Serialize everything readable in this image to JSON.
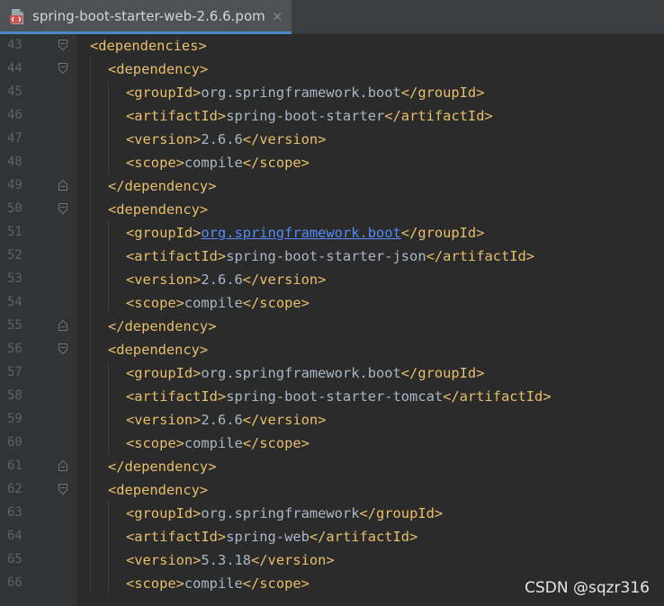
{
  "tab": {
    "title": "spring-boot-starter-web-2.6.6.pom",
    "close_glyph": "×",
    "icon": "maven-pom-file-icon"
  },
  "lines": [
    {
      "n": "43",
      "indent": 0,
      "fold": "open",
      "parts": [
        {
          "k": "tag",
          "t": "<dependencies>"
        }
      ]
    },
    {
      "n": "44",
      "indent": 1,
      "fold": "open",
      "parts": [
        {
          "k": "tag",
          "t": "<dependency>"
        }
      ]
    },
    {
      "n": "45",
      "indent": 2,
      "fold": "",
      "parts": [
        {
          "k": "tag",
          "t": "<groupId>"
        },
        {
          "k": "txt",
          "t": "org.springframework.boot"
        },
        {
          "k": "tag",
          "t": "</groupId>"
        }
      ]
    },
    {
      "n": "46",
      "indent": 2,
      "fold": "",
      "parts": [
        {
          "k": "tag",
          "t": "<artifactId>"
        },
        {
          "k": "txt",
          "t": "spring-boot-starter"
        },
        {
          "k": "tag",
          "t": "</artifactId>"
        }
      ]
    },
    {
      "n": "47",
      "indent": 2,
      "fold": "",
      "parts": [
        {
          "k": "tag",
          "t": "<version>"
        },
        {
          "k": "txt",
          "t": "2.6.6"
        },
        {
          "k": "tag",
          "t": "</version>"
        }
      ]
    },
    {
      "n": "48",
      "indent": 2,
      "fold": "",
      "parts": [
        {
          "k": "tag",
          "t": "<scope>"
        },
        {
          "k": "txt",
          "t": "compile"
        },
        {
          "k": "tag",
          "t": "</scope>"
        }
      ]
    },
    {
      "n": "49",
      "indent": 1,
      "fold": "close",
      "parts": [
        {
          "k": "tag",
          "t": "</dependency>"
        }
      ]
    },
    {
      "n": "50",
      "indent": 1,
      "fold": "open",
      "parts": [
        {
          "k": "tag",
          "t": "<dependency>"
        }
      ]
    },
    {
      "n": "51",
      "indent": 2,
      "fold": "",
      "parts": [
        {
          "k": "tag",
          "t": "<groupId>"
        },
        {
          "k": "link",
          "t": "org.springframework.boot"
        },
        {
          "k": "tag",
          "t": "</groupId>"
        }
      ]
    },
    {
      "n": "52",
      "indent": 2,
      "fold": "",
      "parts": [
        {
          "k": "tag",
          "t": "<artifactId>"
        },
        {
          "k": "txt",
          "t": "spring-boot-starter-json"
        },
        {
          "k": "tag",
          "t": "</artifactId>"
        }
      ]
    },
    {
      "n": "53",
      "indent": 2,
      "fold": "",
      "parts": [
        {
          "k": "tag",
          "t": "<version>"
        },
        {
          "k": "txt",
          "t": "2.6.6"
        },
        {
          "k": "tag",
          "t": "</version>"
        }
      ]
    },
    {
      "n": "54",
      "indent": 2,
      "fold": "",
      "parts": [
        {
          "k": "tag",
          "t": "<scope>"
        },
        {
          "k": "txt",
          "t": "compile"
        },
        {
          "k": "tag",
          "t": "</scope>"
        }
      ]
    },
    {
      "n": "55",
      "indent": 1,
      "fold": "close",
      "parts": [
        {
          "k": "tag",
          "t": "</dependency>"
        }
      ]
    },
    {
      "n": "56",
      "indent": 1,
      "fold": "open",
      "parts": [
        {
          "k": "tag",
          "t": "<dependency>"
        }
      ]
    },
    {
      "n": "57",
      "indent": 2,
      "fold": "",
      "parts": [
        {
          "k": "tag",
          "t": "<groupId>"
        },
        {
          "k": "txt",
          "t": "org.springframework.boot"
        },
        {
          "k": "tag",
          "t": "</groupId>"
        }
      ]
    },
    {
      "n": "58",
      "indent": 2,
      "fold": "",
      "parts": [
        {
          "k": "tag",
          "t": "<artifactId>"
        },
        {
          "k": "txt",
          "t": "spring-boot-starter-tomcat"
        },
        {
          "k": "tag",
          "t": "</artifactId>"
        }
      ]
    },
    {
      "n": "59",
      "indent": 2,
      "fold": "",
      "parts": [
        {
          "k": "tag",
          "t": "<version>"
        },
        {
          "k": "txt",
          "t": "2.6.6"
        },
        {
          "k": "tag",
          "t": "</version>"
        }
      ]
    },
    {
      "n": "60",
      "indent": 2,
      "fold": "",
      "parts": [
        {
          "k": "tag",
          "t": "<scope>"
        },
        {
          "k": "txt",
          "t": "compile"
        },
        {
          "k": "tag",
          "t": "</scope>"
        }
      ]
    },
    {
      "n": "61",
      "indent": 1,
      "fold": "close",
      "parts": [
        {
          "k": "tag",
          "t": "</dependency>"
        }
      ]
    },
    {
      "n": "62",
      "indent": 1,
      "fold": "open",
      "parts": [
        {
          "k": "tag",
          "t": "<dependency>"
        }
      ]
    },
    {
      "n": "63",
      "indent": 2,
      "fold": "",
      "parts": [
        {
          "k": "tag",
          "t": "<groupId>"
        },
        {
          "k": "txt",
          "t": "org.springframework"
        },
        {
          "k": "tag",
          "t": "</groupId>"
        }
      ]
    },
    {
      "n": "64",
      "indent": 2,
      "fold": "",
      "parts": [
        {
          "k": "tag",
          "t": "<artifactId>"
        },
        {
          "k": "txt",
          "t": "spring-web"
        },
        {
          "k": "tag",
          "t": "</artifactId>"
        }
      ]
    },
    {
      "n": "65",
      "indent": 2,
      "fold": "",
      "parts": [
        {
          "k": "tag",
          "t": "<version>"
        },
        {
          "k": "txt",
          "t": "5.3.18"
        },
        {
          "k": "tag",
          "t": "</version>"
        }
      ]
    },
    {
      "n": "66",
      "indent": 2,
      "fold": "",
      "parts": [
        {
          "k": "tag",
          "t": "<scope>"
        },
        {
          "k": "txt",
          "t": "compile"
        },
        {
          "k": "tag",
          "t": "</scope>"
        }
      ]
    }
  ],
  "watermark": "CSDN @sqzr316",
  "colors": {
    "background": "#2b2b2b",
    "gutter": "#313335",
    "tag": "#e8bf6a",
    "text": "#a9b7c6",
    "link": "#548af7",
    "line_number": "#606366",
    "tab_underline": "#4a88c7"
  }
}
